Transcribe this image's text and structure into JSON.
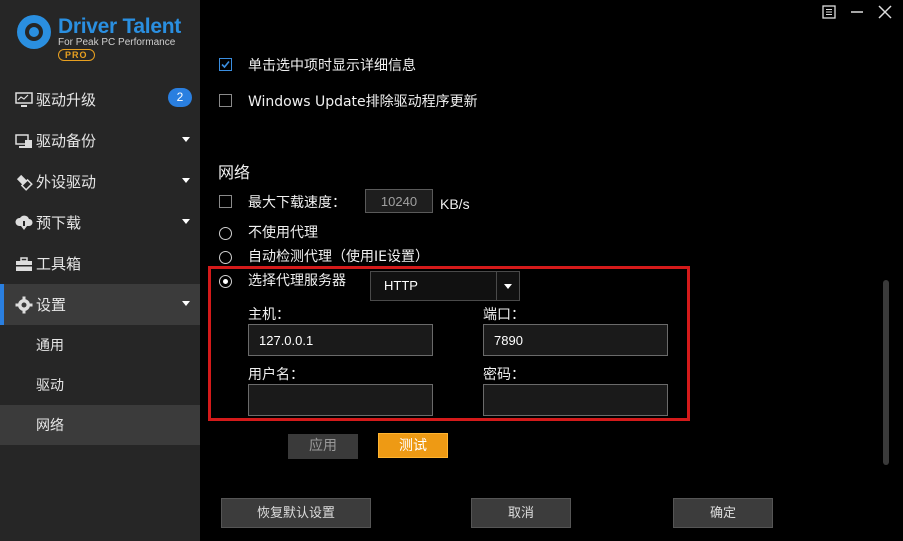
{
  "app": {
    "name": "Driver Talent",
    "tagline": "For Peak PC Performance",
    "edition": "PRO",
    "accent": "#2a7fe0"
  },
  "sidebar": {
    "items": [
      {
        "label": "驱动升级",
        "icon": "monitor-icon",
        "badge": "2"
      },
      {
        "label": "驱动备份",
        "icon": "backup-icon"
      },
      {
        "label": "外设驱动",
        "icon": "usb-icon"
      },
      {
        "label": "预下载",
        "icon": "cloud-download-icon"
      },
      {
        "label": "工具箱",
        "icon": "toolbox-icon"
      },
      {
        "label": "设置",
        "icon": "gear-icon"
      }
    ],
    "sub_items": [
      "通用",
      "驱动",
      "网络"
    ]
  },
  "settings": {
    "show_details_label": "单击选中项时显示详细信息",
    "exclude_wu_label": "Windows Update排除驱动程序更新",
    "network_title": "网络",
    "max_speed_label": "最大下载速度：",
    "max_speed_value": "10240",
    "max_speed_unit": "KB/s",
    "no_proxy_label": "不使用代理",
    "auto_proxy_label": "自动检测代理（使用IE设置）",
    "select_proxy_label": "选择代理服务器",
    "proxy_type": "HTTP",
    "host_label": "主机：",
    "host_value": "127.0.0.1",
    "port_label": "端口：",
    "port_value": "7890",
    "user_label": "用户名：",
    "user_value": "",
    "password_label": "密码：",
    "password_value": "",
    "apply_label": "应用",
    "test_label": "测试"
  },
  "footer": {
    "restore_label": "恢复默认设置",
    "cancel_label": "取消",
    "ok_label": "确定"
  }
}
